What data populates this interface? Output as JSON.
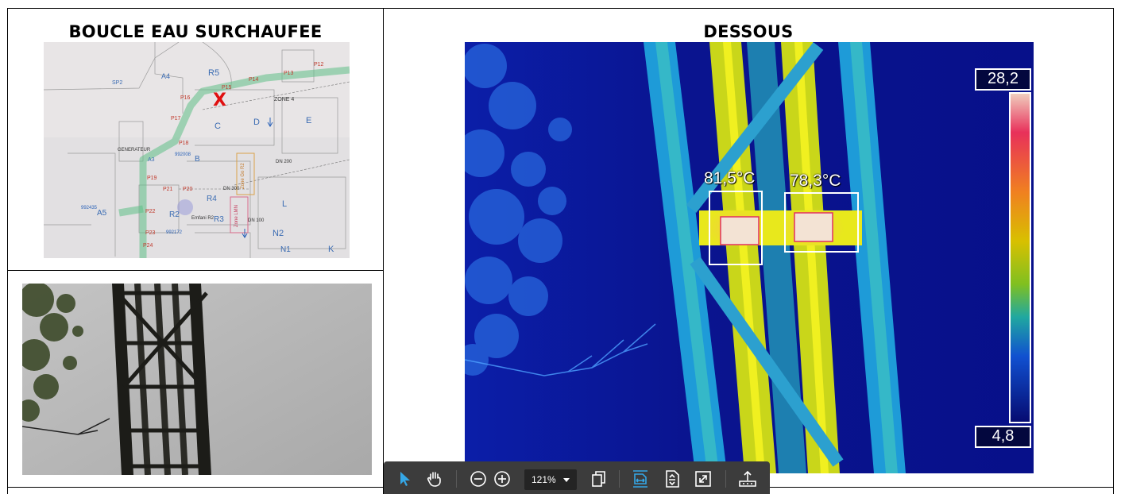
{
  "left_top": {
    "title": "BOUCLE EAU SURCHAUFEE",
    "marker": "X",
    "plan_labels": [
      "R5",
      "A4",
      "SP2",
      "C",
      "D",
      "E",
      "ZONE 4",
      "B",
      "A3",
      "R4",
      "L",
      "A5",
      "R2",
      "N2",
      "N1",
      "K",
      "992008",
      "992435",
      "992172",
      "GENERATEUR",
      "DN 200",
      "DN 300",
      "DN 100",
      "Zone Go R2",
      "Zone LMN",
      "Emfani R2",
      "R3"
    ],
    "pipe_labels": [
      "P12",
      "P13",
      "P14",
      "P15",
      "P16",
      "P17",
      "P18",
      "P19",
      "P20",
      "P21",
      "P22",
      "P23",
      "P24"
    ]
  },
  "right": {
    "title": "DESSOUS",
    "spot1": "81,5°C",
    "spot2": "78,3°C",
    "scale_max": "28,2",
    "scale_min": "4,8"
  },
  "toolbar": {
    "zoom_value": "121%"
  },
  "colors": {
    "thermal_background": "#0a1190",
    "toolbar_bg": "#3c3c3c",
    "active_tool": "#35a7e6",
    "pipe_overlay": "#62c28a"
  },
  "icons": [
    "select-cursor-icon",
    "hand-pan-icon",
    "zoom-out-icon",
    "zoom-in-icon",
    "page-view-icon",
    "fit-width-icon",
    "fit-page-icon",
    "fullscreen-icon",
    "export-icon"
  ]
}
